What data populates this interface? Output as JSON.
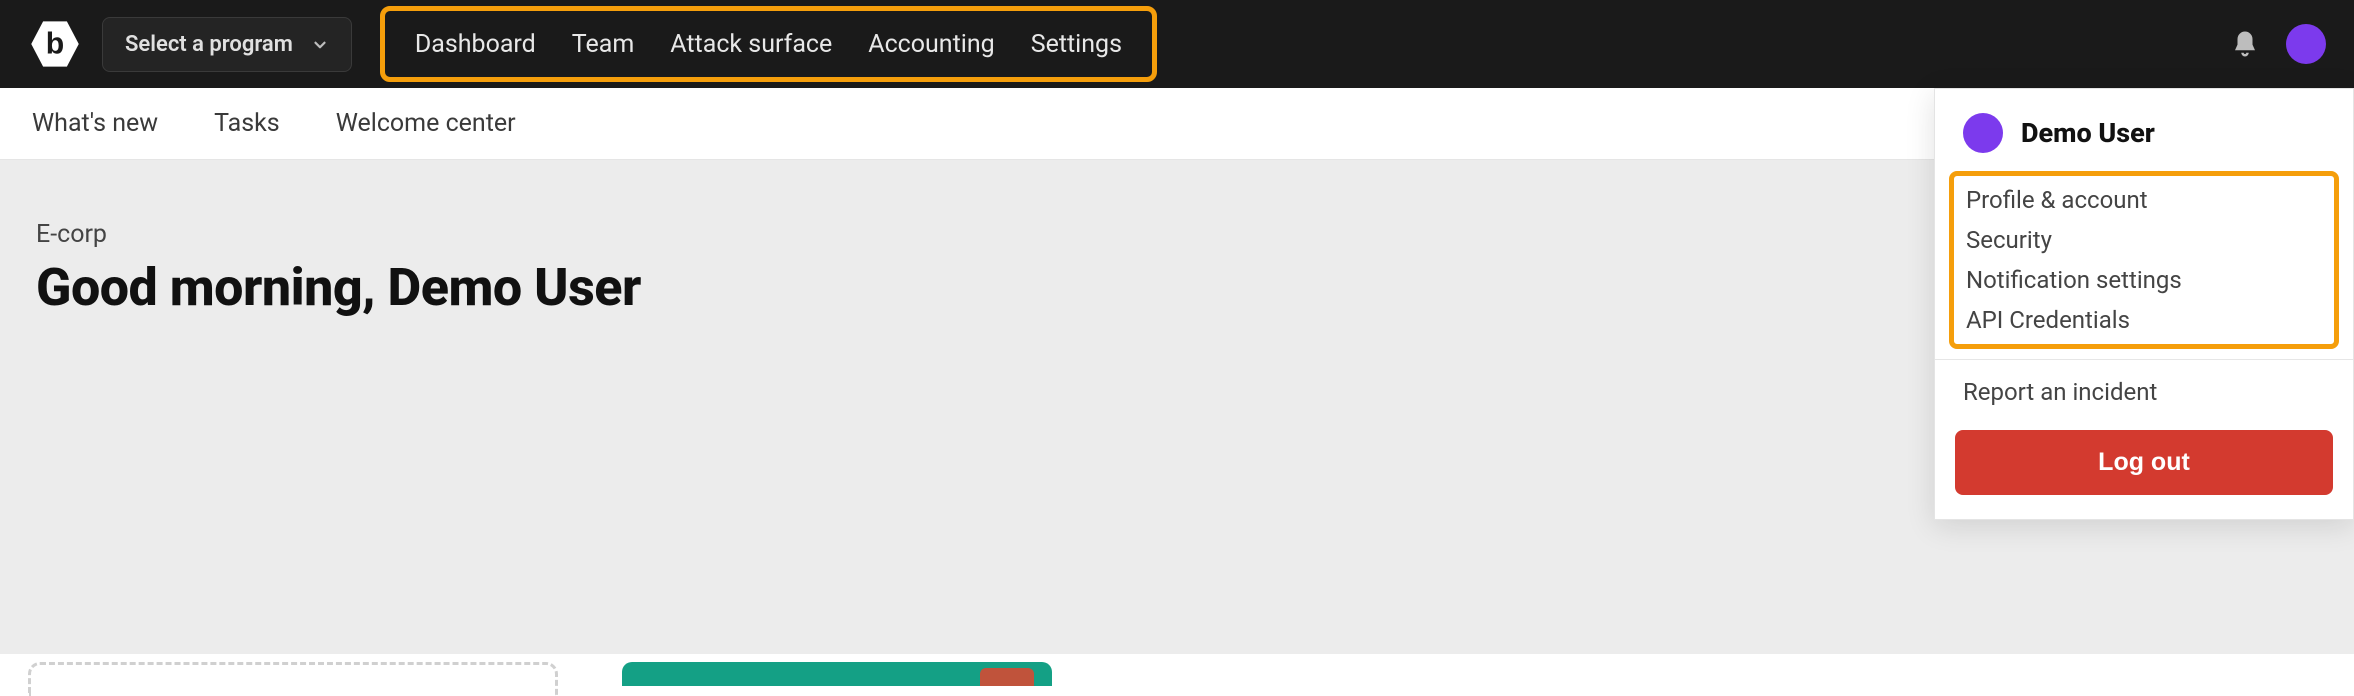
{
  "topbar": {
    "program_select_label": "Select a program",
    "nav": [
      "Dashboard",
      "Team",
      "Attack surface",
      "Accounting",
      "Settings"
    ]
  },
  "subnav": [
    "What's new",
    "Tasks",
    "Welcome center"
  ],
  "hero": {
    "org": "E-corp",
    "greeting": "Good morning, Demo User"
  },
  "user_panel": {
    "name": "Demo User",
    "items": [
      "Profile & account",
      "Security",
      "Notification settings",
      "API Credentials"
    ],
    "report": "Report an incident",
    "logout": "Log out"
  },
  "colors": {
    "highlight": "#f59e0b",
    "accent": "#7c3aed",
    "danger": "#d33a2f",
    "teal": "#14a085"
  }
}
